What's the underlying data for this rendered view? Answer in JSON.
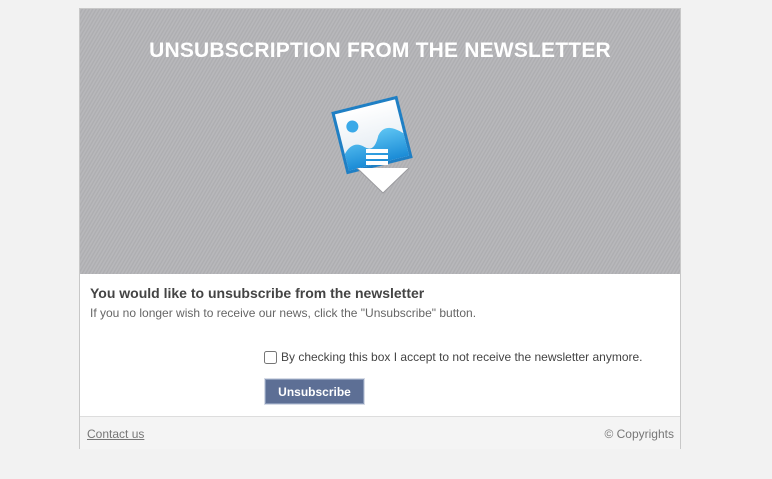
{
  "header": {
    "title": "UNSUBSCRIPTION FROM THE NEWSLETTER",
    "icon": "image-download-icon"
  },
  "content": {
    "heading": "You would like to unsubscribe from the newsletter",
    "subtext": "If you no longer wish to receive our news, click the \"Unsubscribe\" button.",
    "checkbox_label": "By checking this box I accept to not receive the newsletter anymore.",
    "checkbox_checked": false,
    "button_label": "Unsubscribe"
  },
  "footer": {
    "contact_label": "Contact us",
    "copyright": "© Copyrights"
  },
  "colors": {
    "page_bg": "#f2f2f2",
    "hero_bg": "#b3b3b6",
    "button_bg": "#5d6f95",
    "icon_blue": "#2f9fe0"
  }
}
